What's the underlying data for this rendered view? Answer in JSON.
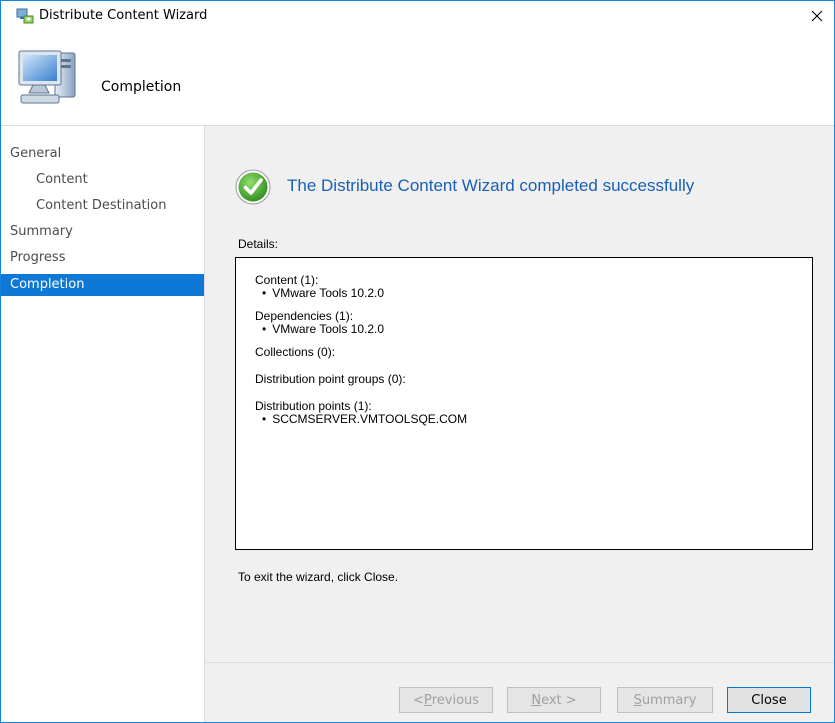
{
  "window": {
    "title": "Distribute Content Wizard",
    "close_glyph": "✕"
  },
  "header": {
    "page_title": "Completion",
    "icon": "computer-icon"
  },
  "sidebar": {
    "items": [
      {
        "label": "General",
        "level": 0
      },
      {
        "label": "Content",
        "level": 1
      },
      {
        "label": "Content Destination",
        "level": 1
      },
      {
        "label": "Summary",
        "level": 0
      },
      {
        "label": "Progress",
        "level": 0
      },
      {
        "label": "Completion",
        "level": 0,
        "selected": true
      }
    ]
  },
  "main": {
    "success_icon": "check-circle-icon",
    "success_message": "The Distribute Content Wizard completed successfully",
    "details_label": "Details:",
    "details": {
      "content": {
        "heading": "Content (1):",
        "items": [
          "VMware Tools 10.2.0"
        ]
      },
      "dependencies": {
        "heading": "Dependencies (1):",
        "items": [
          "VMware Tools 10.2.0"
        ]
      },
      "collections": {
        "heading": "Collections (0):"
      },
      "dp_groups": {
        "heading": "Distribution point groups (0):"
      },
      "dps": {
        "heading": "Distribution points (1):",
        "items": [
          "SCCMSERVER.VMTOOLSQE.COM"
        ]
      }
    },
    "exit_hint": "To exit the wizard, click Close."
  },
  "footer": {
    "previous": {
      "first": "< ",
      "mnemonic": "P",
      "rest": "revious"
    },
    "next": {
      "mnemonic": "N",
      "rest": "ext >"
    },
    "summary": {
      "mnemonic": "S",
      "rest": "ummary"
    },
    "close": "Close"
  },
  "colors": {
    "accent": "#0e78d7",
    "success_text": "#1a5fb4",
    "panel_bg": "#f0f0f0"
  }
}
